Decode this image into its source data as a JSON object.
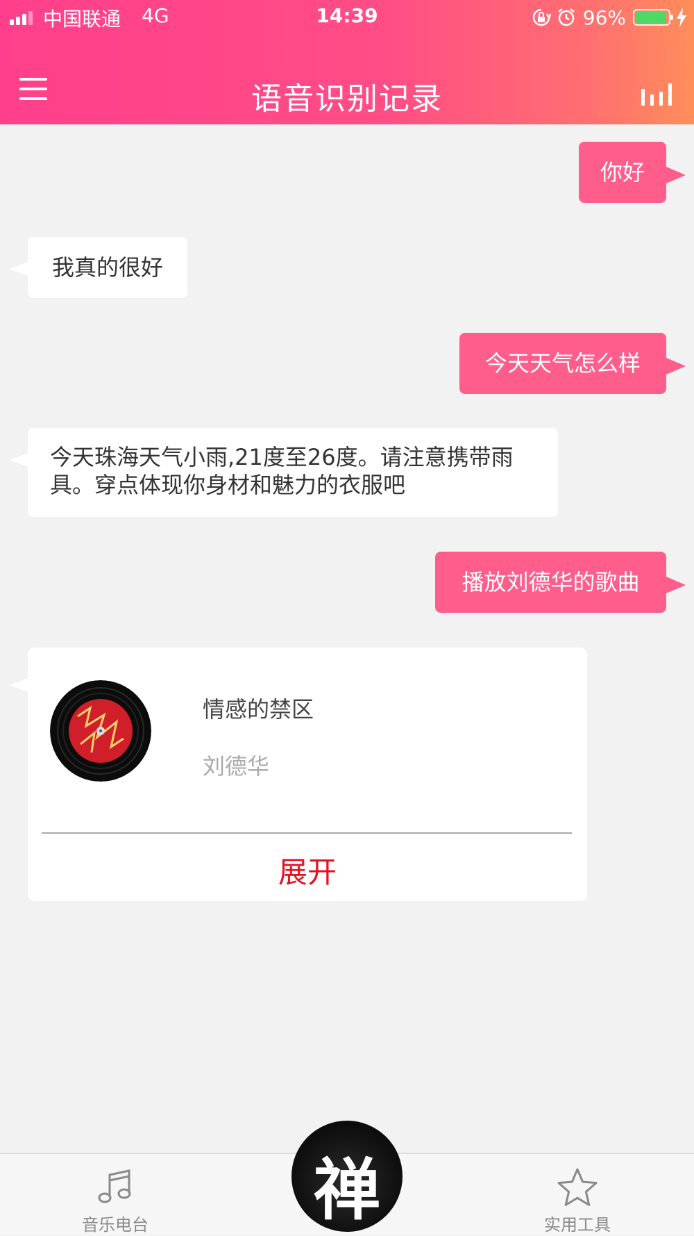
{
  "status_bar": {
    "carrier": "中国联通",
    "network": "4G",
    "time": "14:39",
    "battery_percent": "96%",
    "battery_level": 0.96
  },
  "nav": {
    "title": "语音识别记录",
    "menu_icon": "hamburger-menu-icon",
    "voice_icon": "equalizer-bars-icon"
  },
  "chat": {
    "messages": [
      {
        "side": "right",
        "text": "你好"
      },
      {
        "side": "left",
        "text": "我真的很好"
      },
      {
        "side": "right",
        "text": "今天天气怎么样"
      },
      {
        "side": "left",
        "text": "今天珠海天气小雨,21度至26度。请注意携带雨具。穿点体现你身材和魅力的衣服吧"
      },
      {
        "side": "right",
        "text": "播放刘德华的歌曲"
      }
    ],
    "music_card": {
      "song_title": "情感的禁区",
      "artist": "刘德华",
      "expand_label": "展开",
      "album_icon": "vinyl-record-icon"
    }
  },
  "tabbar": {
    "tabs": [
      {
        "label": "音乐电台",
        "icon": "music-note-icon"
      },
      {
        "label": "实用工具",
        "icon": "star-icon"
      }
    ],
    "center_button": {
      "logo_text": "禅"
    }
  },
  "colors": {
    "header_gradient_start": "#ff3f8b",
    "header_gradient_end": "#ff8e5a",
    "user_bubble": "#ff5e8c",
    "bot_bubble": "#ffffff",
    "expand_text": "#e8101e",
    "background": "#f2f2f2"
  }
}
